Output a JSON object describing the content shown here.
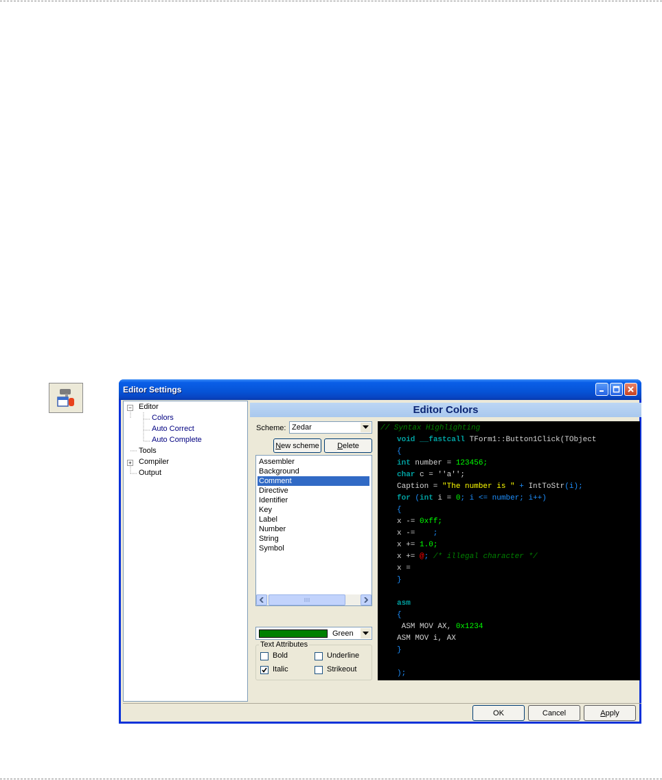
{
  "window": {
    "title": "Editor Settings"
  },
  "tree": {
    "items": [
      {
        "label": "Editor",
        "expander": "−"
      },
      {
        "label": "Colors"
      },
      {
        "label": "Auto Correct"
      },
      {
        "label": "Auto Complete"
      },
      {
        "label": "Tools"
      },
      {
        "label": "Compiler",
        "expander": "+"
      },
      {
        "label": "Output"
      }
    ]
  },
  "header": {
    "title": "Editor Colors"
  },
  "scheme": {
    "label": "Scheme:",
    "value": "Zedar",
    "new_scheme_label": "New scheme",
    "new_scheme_underline": "N",
    "new_scheme_rest": "ew scheme",
    "delete_label": "Delete",
    "delete_underline": "D",
    "delete_rest": "elete"
  },
  "elements_list": {
    "items": [
      "Assembler",
      "Background",
      "Comment",
      "Directive",
      "Identifier",
      "Key",
      "Label",
      "Number",
      "String",
      "Symbol"
    ],
    "selected": "Comment"
  },
  "color_picker": {
    "value": "Green",
    "swatch_color": "#008000"
  },
  "text_attributes": {
    "title": "Text Attributes",
    "bold": {
      "label": "Bold",
      "checked": false
    },
    "underline": {
      "label": "Underline",
      "checked": false
    },
    "italic": {
      "label": "Italic",
      "checked": true
    },
    "strikeout": {
      "label": "Strikeout",
      "checked": false
    }
  },
  "code_preview": {
    "line0": "// Syntax Highlighting",
    "line1_kw1": "void",
    "line1_kw2": "__fastcall",
    "line1_id": " TForm1::Button1Click(TObject",
    "line2": "{",
    "line3_kw": "int",
    "line3_id": " number = ",
    "line3_num": "123456",
    "line3_sym": ";",
    "line4_kw": "char",
    "line4_id": " c = ''a'';",
    "line5_id": "Caption = ",
    "line5_str": "\"The number is \"",
    "line5_sym": " + ",
    "line5_id2": "IntToStr",
    "line5_sym2": "(i);",
    "line6_kw": "for",
    "line6_sym": " (",
    "line6_kw2": "int",
    "line6_id": " i = ",
    "line6_num": "0",
    "line6_sym2": "; i <= number; i++)",
    "line7": "{",
    "line8_id": "x -= ",
    "line8_num": "0xff",
    "line8_sym": ";",
    "line9_id": "x -=",
    "line9_sym": "    ;",
    "line10_id": "x += ",
    "line10_num": "1.0",
    "line10_sym": ";",
    "line11_id": "x += ",
    "line11_ill": "@",
    "line11_sym": "; ",
    "line11_cm": "/* illegal character */",
    "line12_id": "x =",
    "line13": "}",
    "line14_kw": "asm",
    "line15": "{",
    "line16_id": " ASM MOV AX, ",
    "line16_num": "0x1234",
    "line17_id": "ASM MOV i, AX",
    "line18": "}",
    "line19": ");"
  },
  "footer": {
    "ok_label": "OK",
    "cancel_label": "Cancel",
    "apply_label": "Apply",
    "apply_underline": "A",
    "apply_rest": "pply"
  },
  "icons": {
    "tool": "settings-tool-icon",
    "minimize": "minimize-icon",
    "maximize": "maximize-icon",
    "close": "close-icon"
  }
}
